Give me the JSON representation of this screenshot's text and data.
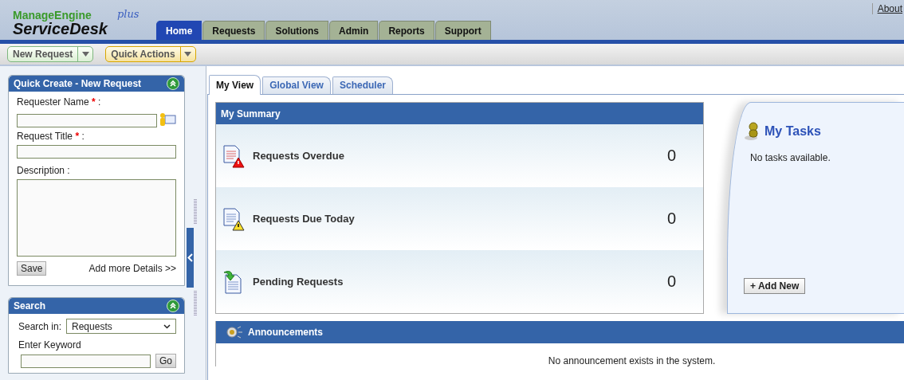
{
  "header": {
    "logo_top": "ManageEngine",
    "logo_main": "ServiceDesk",
    "logo_suffix": "plus",
    "about_link": "About"
  },
  "nav_tabs": [
    {
      "label": "Home",
      "selected": true
    },
    {
      "label": "Requests",
      "selected": false
    },
    {
      "label": "Solutions",
      "selected": false
    },
    {
      "label": "Admin",
      "selected": false
    },
    {
      "label": "Reports",
      "selected": false
    },
    {
      "label": "Support",
      "selected": false
    }
  ],
  "toolbar": [
    {
      "label": "New Request",
      "kind": "create"
    },
    {
      "label": "Quick Actions",
      "kind": "actions"
    }
  ],
  "quick_create": {
    "title": "Quick Create - New Request",
    "fields": [
      {
        "label": "Requester Name",
        "required_mark": "*",
        "suffix": ":",
        "kind": "lookup"
      },
      {
        "label": "Request Title",
        "required_mark": "*",
        "suffix": ":",
        "kind": "text"
      },
      {
        "label": "Description :",
        "kind": "textarea"
      }
    ],
    "save_button": "Save",
    "more_link": "Add more Details >>"
  },
  "search": {
    "title": "Search",
    "search_in_label": "Search in:",
    "search_in_value": "Requests",
    "keyword_label": "Enter Keyword",
    "go_button": "Go"
  },
  "view_tabs": [
    {
      "label": "My View",
      "selected": true
    },
    {
      "label": "Global View",
      "selected": false
    },
    {
      "label": "Scheduler",
      "selected": false
    }
  ],
  "summary": {
    "title": "My Summary",
    "rows": [
      {
        "label": "Requests Overdue",
        "count": "0",
        "kind": "overdue"
      },
      {
        "label": "Requests Due Today",
        "count": "0",
        "kind": "due-today"
      },
      {
        "label": "Pending Requests",
        "count": "0",
        "kind": "pending"
      }
    ]
  },
  "tasks": {
    "title": "My Tasks",
    "empty_message": "No tasks available.",
    "add_button": "+ Add New"
  },
  "announcements": {
    "title": "Announcements",
    "message": "No announcement exists in the system."
  }
}
